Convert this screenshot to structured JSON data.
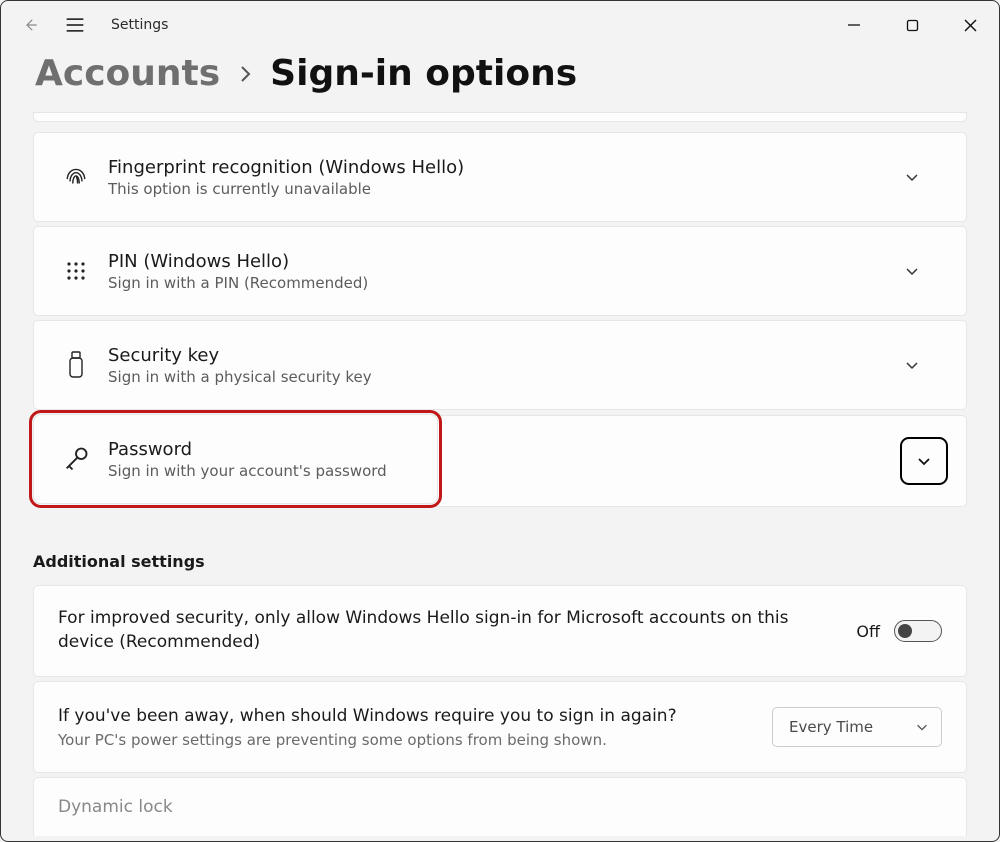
{
  "app_title": "Settings",
  "breadcrumb": {
    "parent": "Accounts",
    "current": "Sign-in options"
  },
  "options": {
    "fingerprint": {
      "title": "Fingerprint recognition (Windows Hello)",
      "sub": "This option is currently unavailable"
    },
    "pin": {
      "title": "PIN (Windows Hello)",
      "sub": "Sign in with a PIN (Recommended)"
    },
    "seckey": {
      "title": "Security key",
      "sub": "Sign in with a physical security key"
    },
    "password": {
      "title": "Password",
      "sub": "Sign in with your account's password"
    }
  },
  "additional_header": "Additional settings",
  "hello_only": {
    "text": "For improved security, only allow Windows Hello sign-in for Microsoft accounts on this device (Recommended)",
    "toggle_label": "Off"
  },
  "reauth": {
    "text": "If you've been away, when should Windows require you to sign in again?",
    "sub": "Your PC's power settings are preventing some options from being shown.",
    "combo_value": "Every Time"
  },
  "dynamic_lock_stub": "Dynamic lock"
}
